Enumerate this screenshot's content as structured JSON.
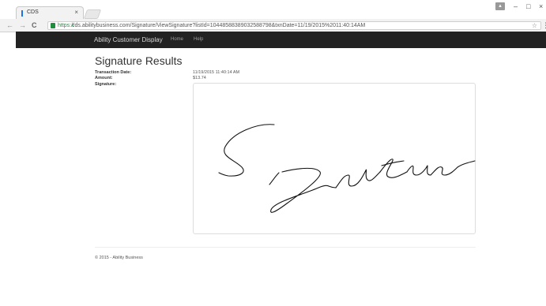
{
  "browser": {
    "tab_title": "CDS",
    "tab_close": "×",
    "url_secure": "https://",
    "url_rest": "cds.abilitybusiness.com/Signature/ViewSignature?listId=10448588389032588798&txnDate=11/19/2015%2011:40:14AM",
    "user_icon": "▴",
    "window_controls": [
      "–",
      "□",
      "×"
    ]
  },
  "navbar": {
    "brand": "Ability Customer Display",
    "links": [
      "Home",
      "Help"
    ]
  },
  "page": {
    "title": "Signature Results",
    "fields": [
      {
        "label": "Transaction Date:",
        "value": "11/19/2015 11:40:14 AM"
      },
      {
        "label": "Amount:",
        "value": "$13.74"
      },
      {
        "label": "Signature:",
        "value": ""
      }
    ]
  },
  "footer": {
    "text": "© 2015 - Ability Business"
  }
}
